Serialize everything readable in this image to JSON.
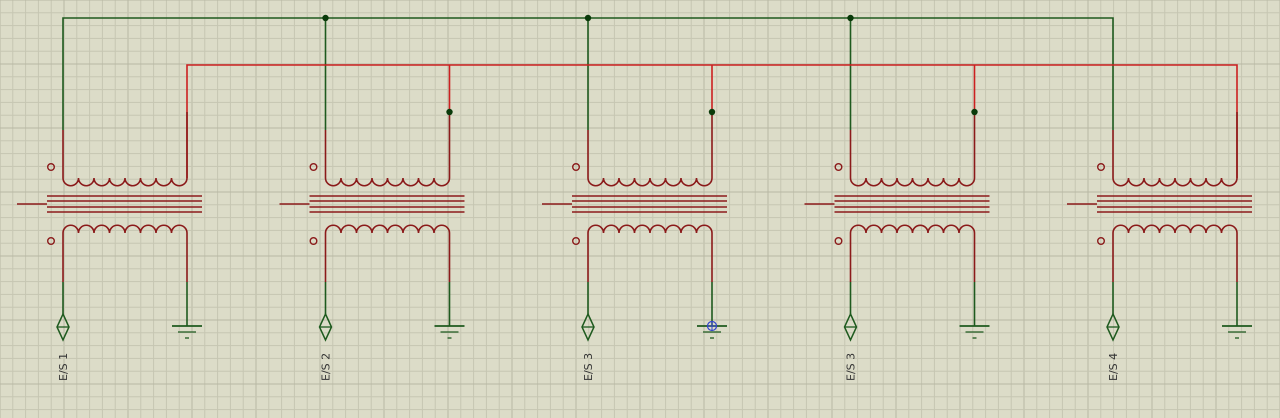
{
  "colors": {
    "background": "#dcdcc8",
    "grid_minor": "#c6c6b2",
    "grid_major": "#b8b8a4",
    "wire_primary": "#1e5a1e",
    "wire_secondary": "#cc2020",
    "component_body": "#8b1a1a",
    "junction": "#0a3a0a",
    "probe_marker": "#3344cc",
    "label_text": "#333333"
  },
  "icons": {
    "transformer": "transformer-icon",
    "terminal": "bidirectional-terminal-icon",
    "ground": "ground-icon"
  },
  "transformers": [
    {
      "label": "E/S 1",
      "has_tap_junction": false,
      "has_probe": false
    },
    {
      "label": "E/S 2",
      "has_tap_junction": true,
      "has_probe": false
    },
    {
      "label": "E/S 3",
      "has_tap_junction": true,
      "has_probe": true
    },
    {
      "label": "E/S 3",
      "has_tap_junction": true,
      "has_probe": false
    },
    {
      "label": "E/S 4",
      "has_tap_junction": false,
      "has_probe": false
    }
  ]
}
